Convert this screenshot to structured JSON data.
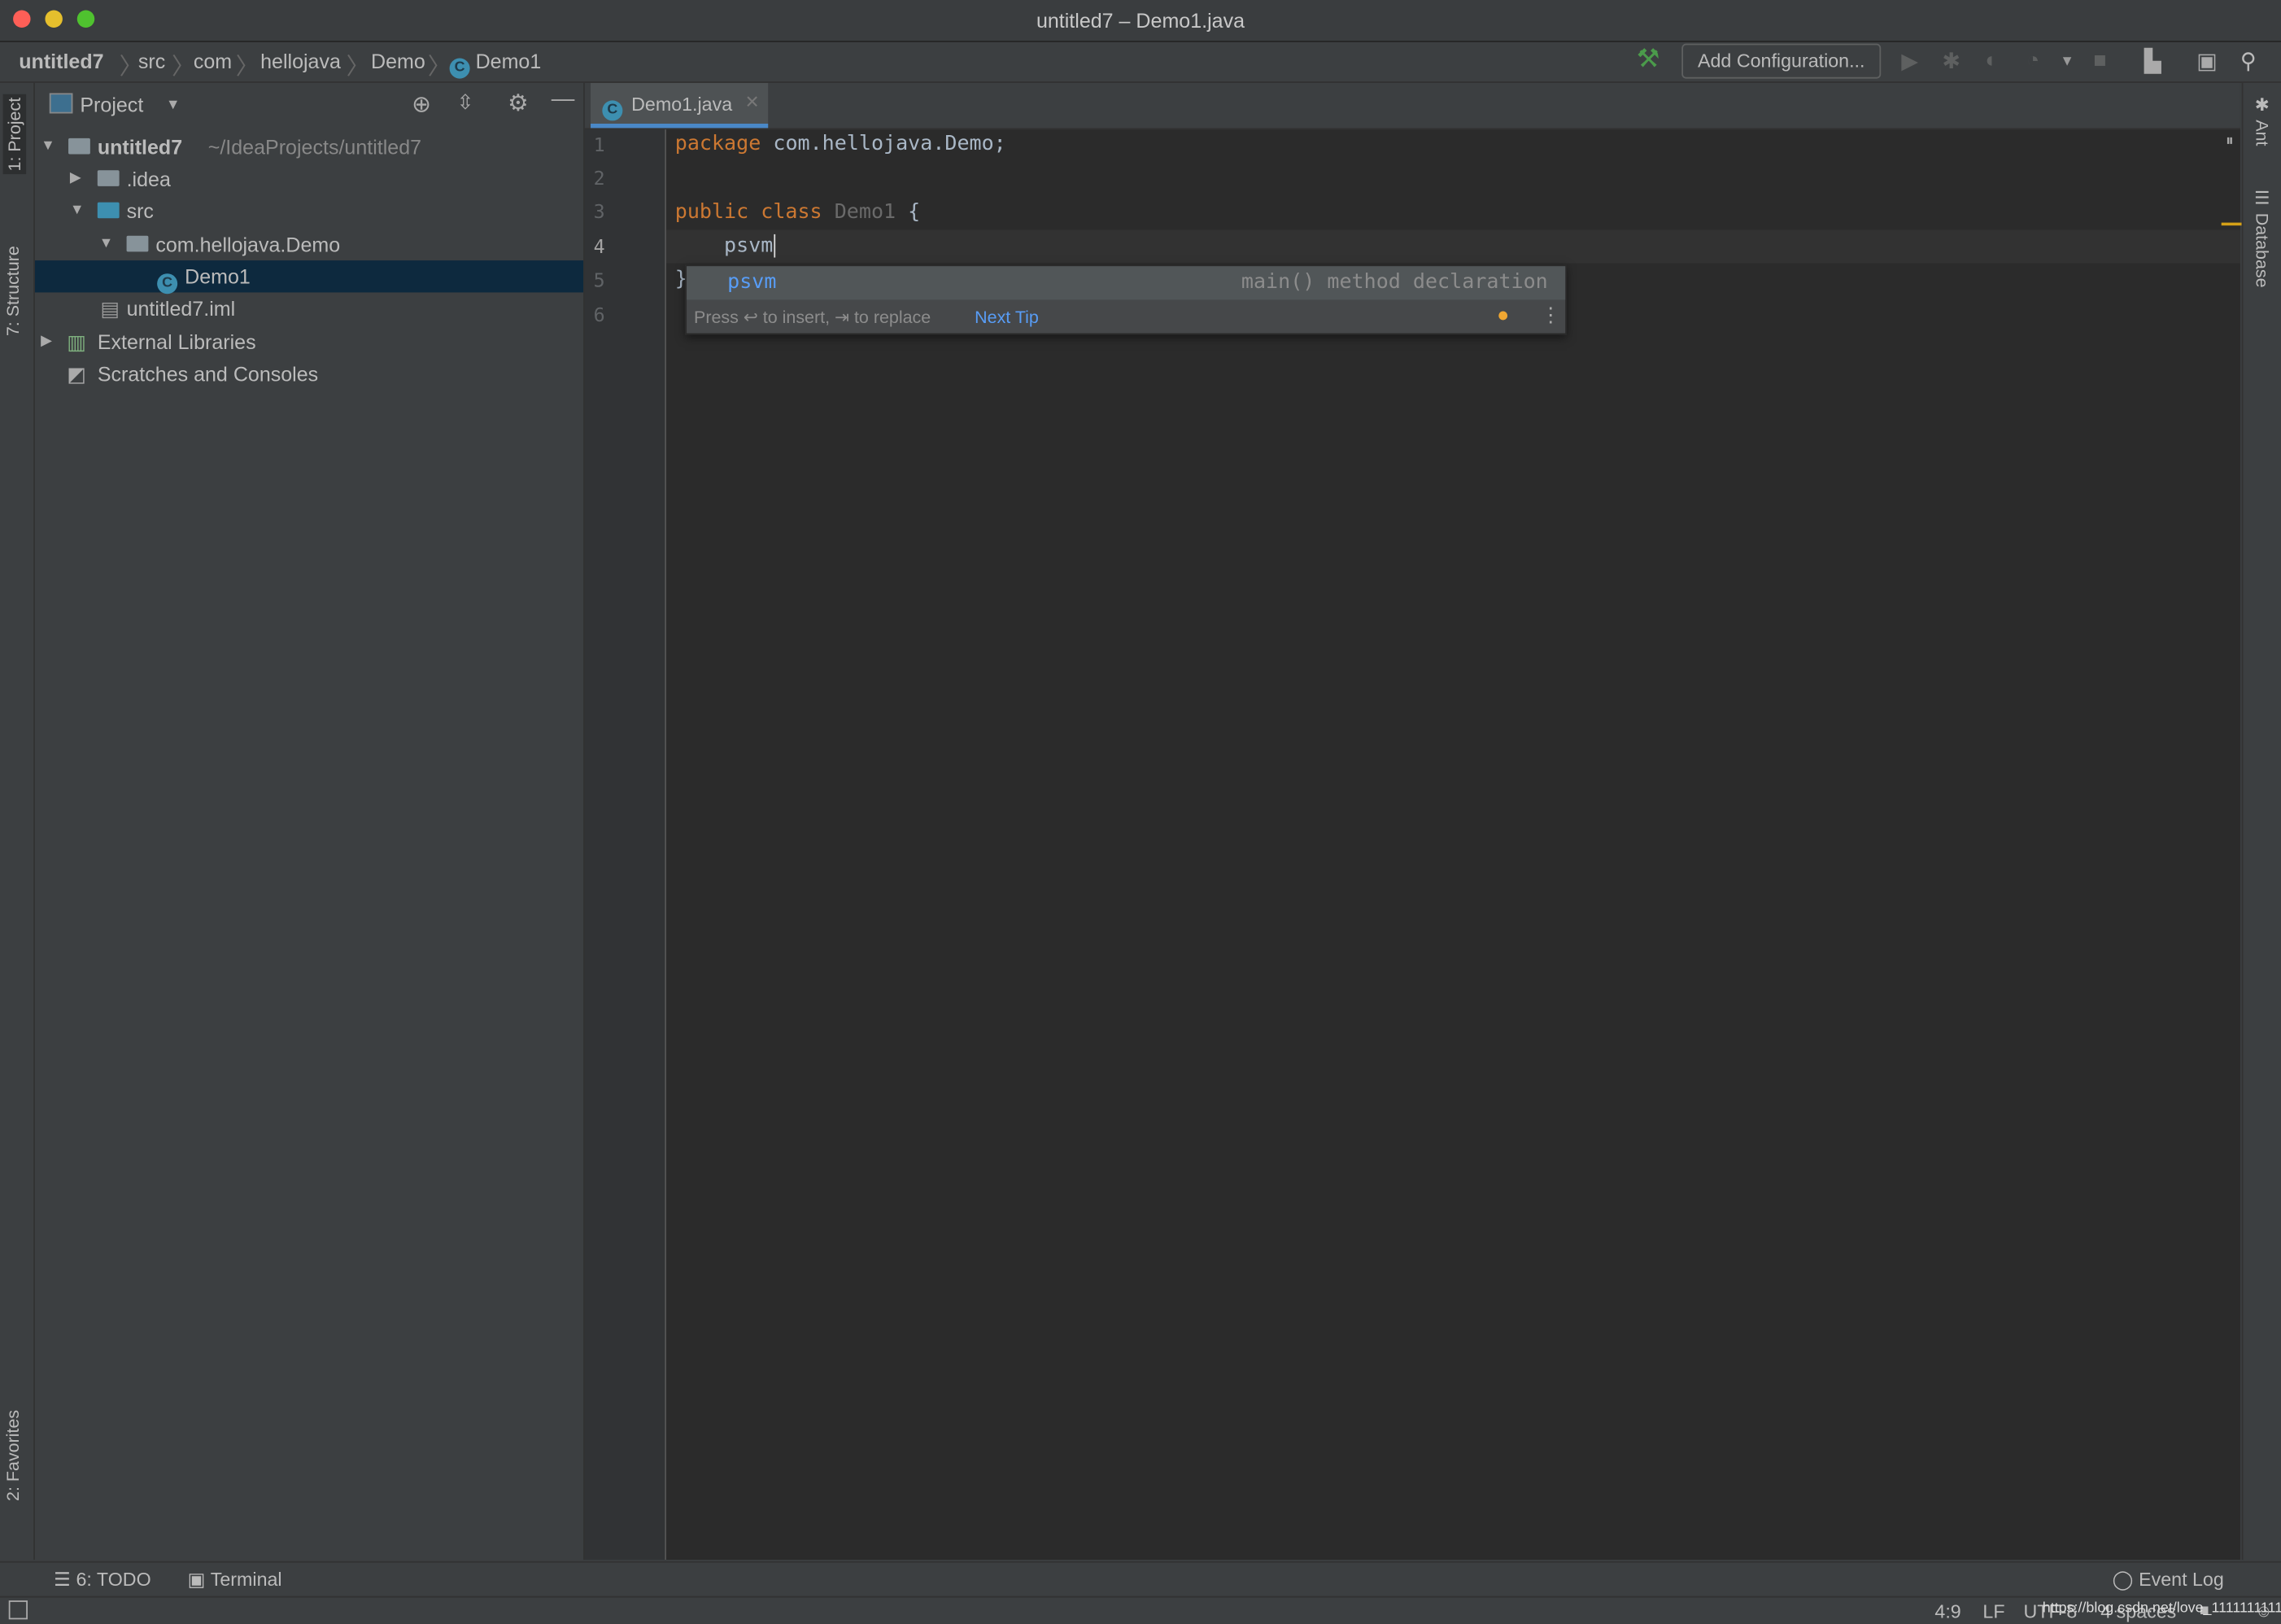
{
  "window": {
    "title": "untitled7 – Demo1.java"
  },
  "breadcrumb": [
    "untitled7",
    "src",
    "com",
    "hellojava",
    "Demo",
    "Demo1"
  ],
  "toolbar": {
    "add_configuration": "Add Configuration...",
    "icons": [
      "build-hammer-icon",
      "run-icon",
      "debug-icon",
      "coverage-icon",
      "profile-icon",
      "stop-icon",
      "project-structure-icon",
      "terminal-icon",
      "search-icon"
    ]
  },
  "left_stripe": {
    "project": "1: Project",
    "structure": "7: Structure",
    "favorites": "2: Favorites"
  },
  "right_stripe": {
    "ant": "Ant",
    "database": "Database"
  },
  "project_panel": {
    "title": "Project",
    "tree": [
      {
        "label": "untitled7",
        "path": "~/IdeaProjects/untitled7",
        "expanded": true
      },
      {
        "label": ".idea",
        "expanded": false
      },
      {
        "label": "src",
        "expanded": true
      },
      {
        "label": "com.hellojava.Demo",
        "expanded": true
      },
      {
        "label": "Demo1",
        "selected": true
      },
      {
        "label": "untitled7.iml"
      },
      {
        "label": "External Libraries",
        "expanded": false
      },
      {
        "label": "Scratches and Consoles"
      }
    ]
  },
  "editor": {
    "tab": "Demo1.java",
    "line_numbers": [
      "1",
      "2",
      "3",
      "4",
      "5",
      "6"
    ],
    "lines": {
      "l1_kw": "package",
      "l1_rest": " com.hellojava.Demo;",
      "l3_kw": "public class",
      "l3_name": " Demo1",
      "l3_rest": " {",
      "l4": "    psvm",
      "l5": "}"
    }
  },
  "completion": {
    "item": "psvm",
    "description": "main() method declaration",
    "hint": "Press ↩ to insert, ⇥ to replace",
    "next_tip": "Next Tip"
  },
  "bottom_bar": {
    "todo": "6: TODO",
    "terminal": "Terminal",
    "event_log": "Event Log"
  },
  "status": {
    "position": "4:9",
    "line_sep": "LF",
    "encoding": "UTF-8",
    "indent": "4 spaces",
    "watermark": "https://blog.csdn.net/love_1111111111"
  },
  "colors": {
    "accent": "#4a88c7",
    "keyword": "#cc7832",
    "selection": "#0d293e",
    "completion": "#589df6"
  }
}
